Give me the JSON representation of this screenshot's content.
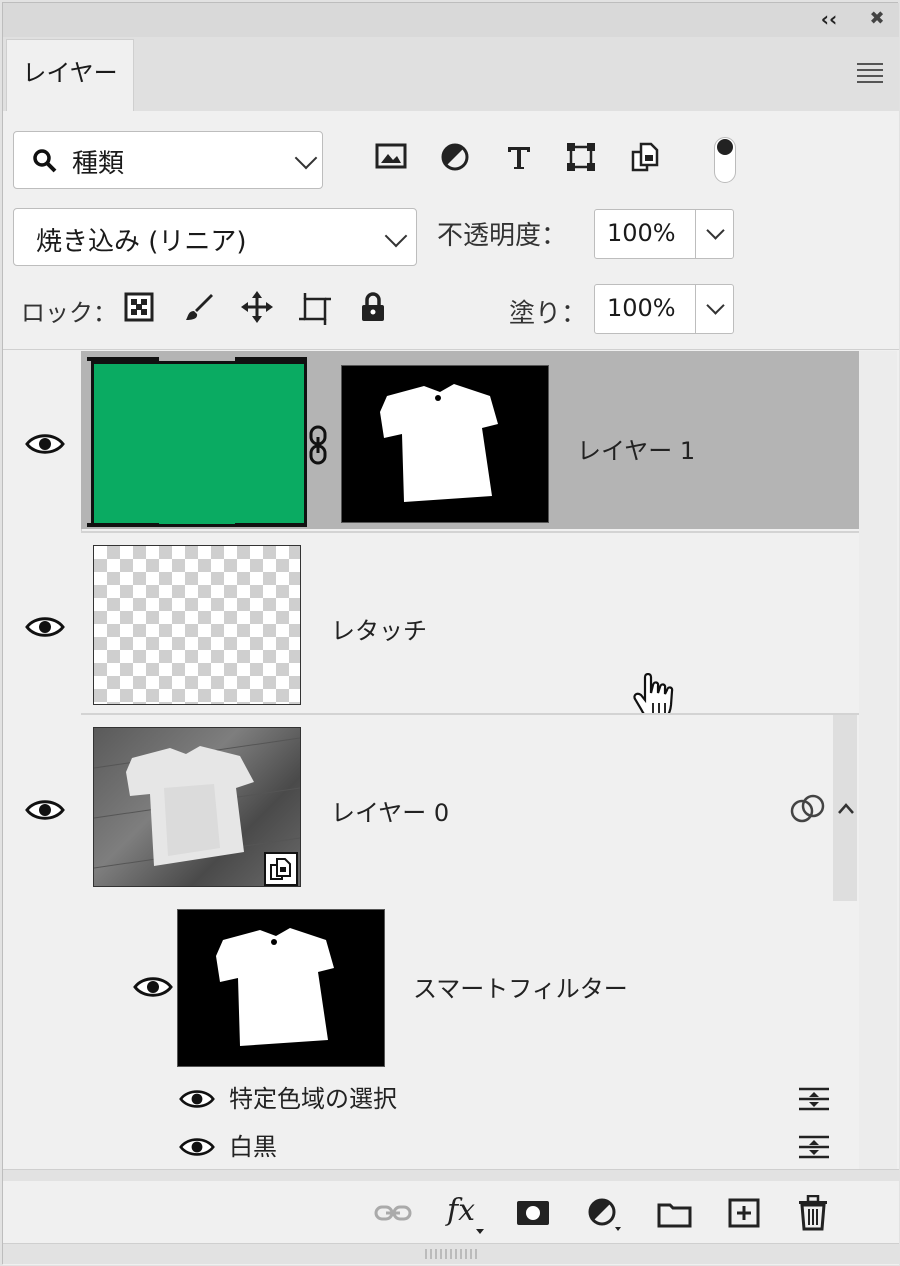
{
  "panel": {
    "tab_label": "レイヤー",
    "collapse_glyph": "‹‹",
    "close_glyph": "✖"
  },
  "filter": {
    "kind_label": "種類",
    "icons": [
      "image-filter-icon",
      "adjustment-filter-icon",
      "type-filter-icon",
      "shape-filter-icon",
      "smart-object-filter-icon"
    ]
  },
  "blend": {
    "mode": "焼き込み (リニア)",
    "opacity_label": "不透明度：",
    "opacity_value": "100%"
  },
  "lock": {
    "label": "ロック：",
    "fill_label": "塗り：",
    "fill_value": "100%"
  },
  "layers": [
    {
      "name": "レイヤー 1",
      "selected": true
    },
    {
      "name": "レタッチ",
      "selected": false
    },
    {
      "name": "レイヤー 0",
      "selected": false
    }
  ],
  "smart_filters": {
    "label": "スマートフィルター",
    "items": [
      {
        "name": "特定色域の選択"
      },
      {
        "name": "白黒"
      }
    ]
  },
  "colors": {
    "fill_swatch": "#0aab62",
    "selected_row": "#b4b4b4"
  },
  "bottom_bar_icons": [
    "link-layers-icon",
    "fx-icon",
    "add-mask-icon",
    "adjustment-layer-icon",
    "new-group-icon",
    "new-layer-icon",
    "delete-layer-icon"
  ]
}
